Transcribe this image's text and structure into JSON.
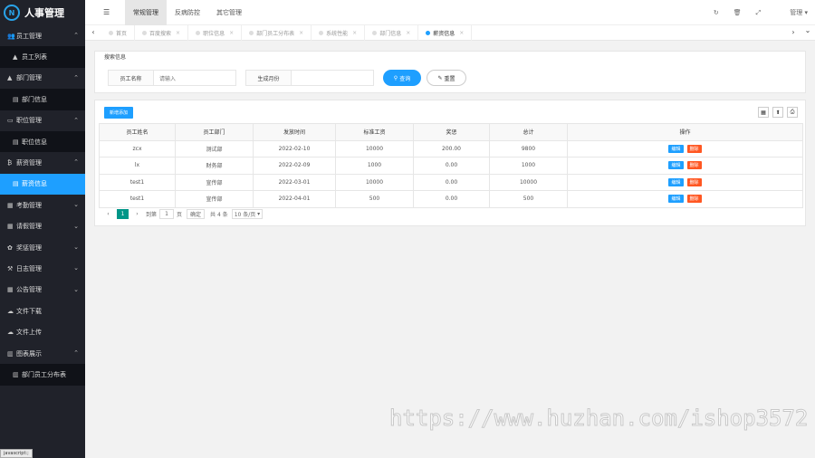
{
  "app": {
    "title": "人事管理",
    "logo_mark": "N"
  },
  "sidebar": {
    "items": [
      {
        "label": "员工管理",
        "icon": "users-icon",
        "glyph": "👥",
        "expandable": true,
        "child": false,
        "active": false
      },
      {
        "label": "员工列表",
        "icon": "user-icon",
        "glyph": "▲",
        "child": true,
        "active": false
      },
      {
        "label": "部门管理",
        "icon": "user-icon",
        "glyph": "▲",
        "expandable": true,
        "child": false,
        "active": false
      },
      {
        "label": "部门信息",
        "icon": "list-icon",
        "glyph": "▤",
        "child": true,
        "active": false
      },
      {
        "label": "职位管理",
        "icon": "briefcase-icon",
        "glyph": "▭",
        "expandable": true,
        "child": false,
        "active": false
      },
      {
        "label": "职位信息",
        "icon": "list-icon",
        "glyph": "▤",
        "child": true,
        "active": false
      },
      {
        "label": "薪资管理",
        "icon": "yen-icon",
        "glyph": "₿",
        "expandable": true,
        "child": false,
        "active": false
      },
      {
        "label": "薪资信息",
        "icon": "list-icon",
        "glyph": "▤",
        "child": true,
        "active": true
      },
      {
        "label": "考勤管理",
        "icon": "calendar-icon",
        "glyph": "▦",
        "expandable": true,
        "child": false,
        "active": false
      },
      {
        "label": "请假管理",
        "icon": "calendar-icon",
        "glyph": "▦",
        "expandable": true,
        "child": false,
        "active": false
      },
      {
        "label": "奖惩管理",
        "icon": "gear-icon",
        "glyph": "✿",
        "expandable": true,
        "child": false,
        "active": false
      },
      {
        "label": "日志管理",
        "icon": "gavel-icon",
        "glyph": "⚒",
        "expandable": true,
        "child": false,
        "active": false
      },
      {
        "label": "公告管理",
        "icon": "calendar-icon",
        "glyph": "▦",
        "expandable": true,
        "child": false,
        "active": false
      },
      {
        "label": "文件下载",
        "icon": "cloud-download-icon",
        "glyph": "☁",
        "child": false,
        "active": false
      },
      {
        "label": "文件上传",
        "icon": "cloud-upload-icon",
        "glyph": "☁",
        "child": false,
        "active": false
      },
      {
        "label": "图表展示",
        "icon": "bar-chart-icon",
        "glyph": "▥",
        "expandable": true,
        "child": false,
        "active": false
      },
      {
        "label": "部门员工分布表",
        "icon": "bar-chart-icon",
        "glyph": "▥",
        "child": true,
        "active": false
      }
    ]
  },
  "status_bar": "javascript:;",
  "topbar": {
    "menu_icon": "☰",
    "nav": [
      {
        "label": "常规管理",
        "active": true
      },
      {
        "label": "反病防控",
        "active": false
      },
      {
        "label": "其它管理",
        "active": false
      }
    ],
    "icons": [
      "↻",
      "🗑",
      "⤢"
    ],
    "user": "管理"
  },
  "tabs": {
    "left_arrow": "‹",
    "right_arrow": "›",
    "down_arrow": "⌄",
    "items": [
      {
        "label": "首页",
        "active": false,
        "closable": false
      },
      {
        "label": "百度搜索",
        "active": false,
        "closable": true
      },
      {
        "label": "职位信息",
        "active": false,
        "closable": true
      },
      {
        "label": "部门员工分布表",
        "active": false,
        "closable": true
      },
      {
        "label": "系统性能",
        "active": false,
        "closable": true
      },
      {
        "label": "部门信息",
        "active": false,
        "closable": true
      },
      {
        "label": "薪资信息",
        "active": true,
        "closable": true
      }
    ]
  },
  "search": {
    "legend": "搜索信息",
    "name_label": "员工名称",
    "name_placeholder": "请输入",
    "month_label": "生成月份",
    "month_value": "",
    "query_button": "查询",
    "reset_button": "重置"
  },
  "table": {
    "add_button": "新增添加",
    "columns": [
      "员工姓名",
      "员工部门",
      "发放时间",
      "标准工资",
      "奖惩",
      "总计",
      "操作"
    ],
    "rows": [
      [
        "zcx",
        "测试部",
        "2022-02-10",
        "10000",
        "200.00",
        "9800"
      ],
      [
        "lx",
        "财务部",
        "2022-02-09",
        "1000",
        "0.00",
        "1000"
      ],
      [
        "test1",
        "宣传部",
        "2022-03-01",
        "10000",
        "0.00",
        "10000"
      ],
      [
        "test1",
        "宣传部",
        "2022-04-01",
        "500",
        "0.00",
        "500"
      ]
    ],
    "edit_label": "编辑",
    "delete_label": "删除"
  },
  "pager": {
    "prev": "‹",
    "current": "1",
    "next": "›",
    "goto_label": "到第",
    "goto_value": "1",
    "page_unit": "页",
    "confirm": "确定",
    "total": "共 4 条",
    "page_size": "10 条/页"
  },
  "watermark": "https://www.huzhan.com/ishop3572",
  "colors": {
    "accent": "#1e9fff",
    "danger": "#ff5722",
    "pager_active": "#009688",
    "sidebar_bg": "#20222a"
  }
}
